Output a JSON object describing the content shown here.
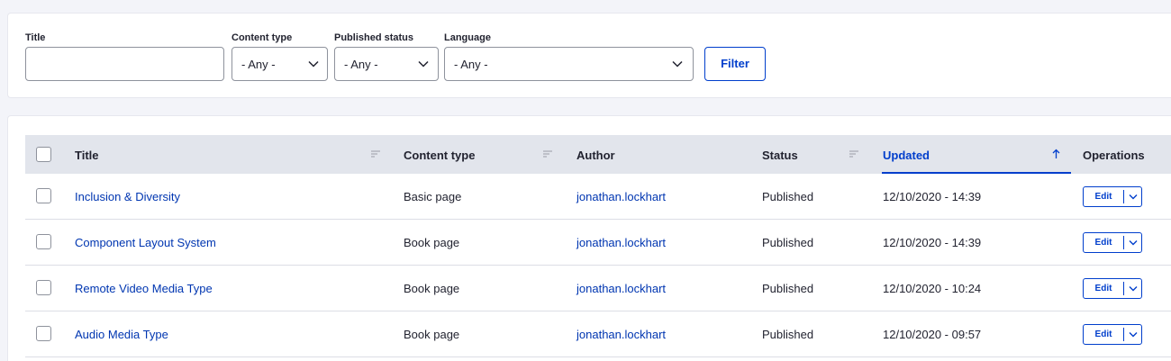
{
  "filters": {
    "title_label": "Title",
    "title_value": "",
    "content_type_label": "Content type",
    "content_type_value": "- Any -",
    "published_status_label": "Published status",
    "published_status_value": "- Any -",
    "language_label": "Language",
    "language_value": "- Any -",
    "filter_button": "Filter"
  },
  "table": {
    "columns": {
      "title": "Title",
      "content_type": "Content type",
      "author": "Author",
      "status": "Status",
      "updated": "Updated",
      "operations": "Operations"
    },
    "sorted_column": "Updated",
    "sort_direction": "ascending",
    "rows": [
      {
        "title": "Inclusion & Diversity",
        "content_type": "Basic page",
        "author": "jonathan.lockhart",
        "status": "Published",
        "updated": "12/10/2020 - 14:39",
        "op": "Edit"
      },
      {
        "title": "Component Layout System",
        "content_type": "Book page",
        "author": "jonathan.lockhart",
        "status": "Published",
        "updated": "12/10/2020 - 14:39",
        "op": "Edit"
      },
      {
        "title": "Remote Video Media Type",
        "content_type": "Book page",
        "author": "jonathan.lockhart",
        "status": "Published",
        "updated": "12/10/2020 - 10:24",
        "op": "Edit"
      },
      {
        "title": "Audio Media Type",
        "content_type": "Book page",
        "author": "jonathan.lockhart",
        "status": "Published",
        "updated": "12/10/2020 - 09:57",
        "op": "Edit"
      }
    ]
  },
  "colors": {
    "accent": "#003ecc",
    "link": "#0036b1",
    "header_bg": "#e2e5ec",
    "page_bg": "#f3f4f9"
  },
  "icons": {
    "select_arrow": "chevron-down-icon",
    "column_sort": "sort-lines-icon",
    "active_sort": "arrow-up-icon",
    "ops_toggle": "chevron-down-icon"
  }
}
